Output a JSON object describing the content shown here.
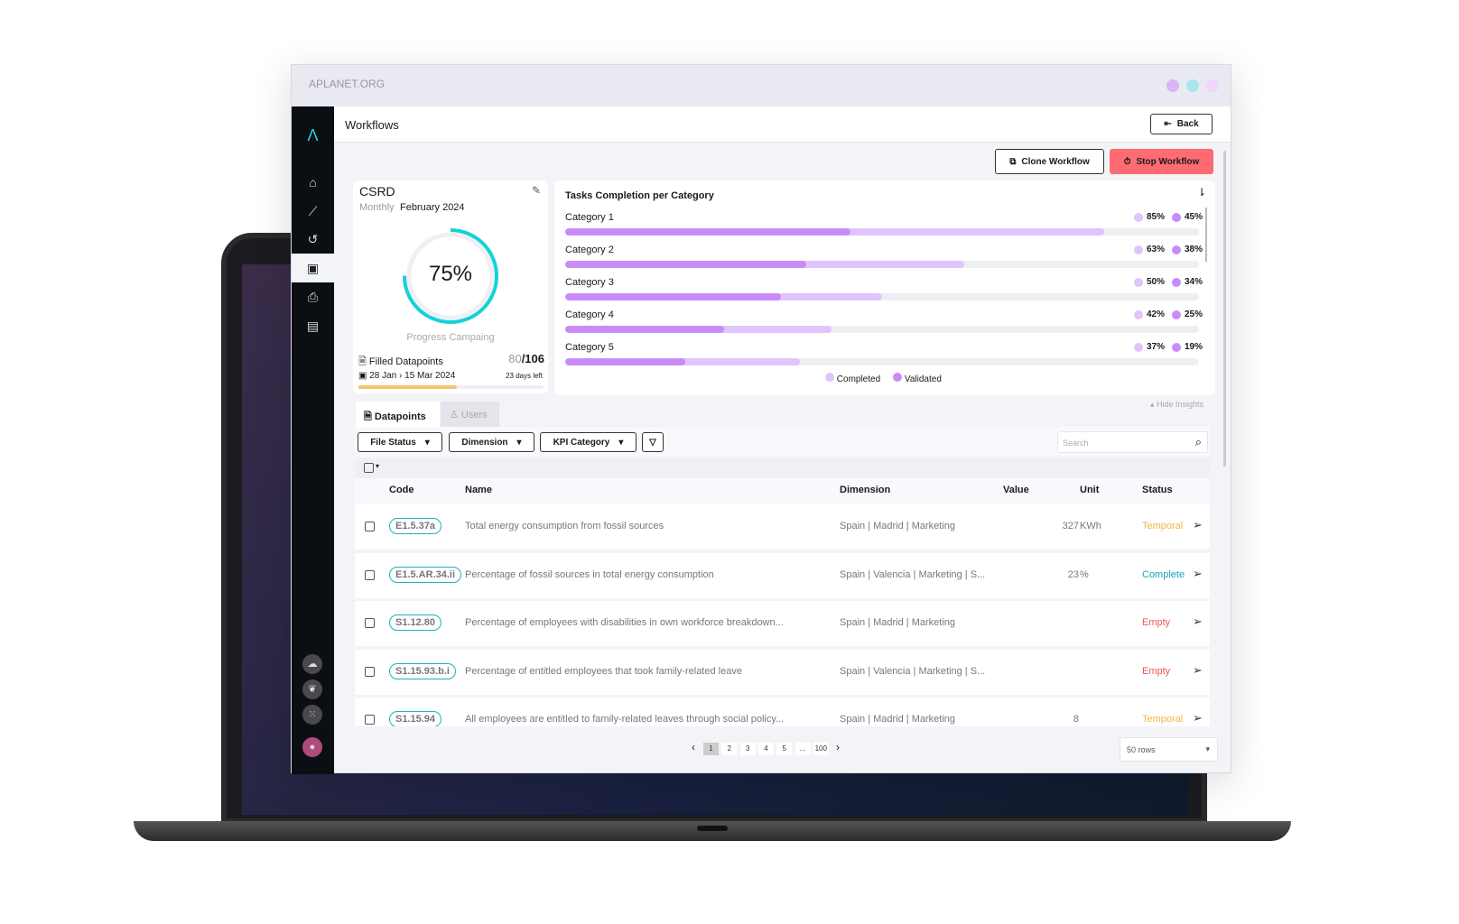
{
  "window": {
    "title": "APLANET.ORG",
    "dots": [
      "#d9b6f5",
      "#a8e6ea",
      "#f0d6fa"
    ]
  },
  "header": {
    "title": "Workflows",
    "back": "Back"
  },
  "actions": {
    "clone": "Clone Workflow",
    "stop": "Stop Workflow",
    "stop_color": "#ff6b72"
  },
  "campaign": {
    "name": "CSRD",
    "frequency": "Monthly",
    "period": "February 2024",
    "progress": 75,
    "progress_label": "75%",
    "progress_caption": "Progress Campaing",
    "filled_label": "Filled Datapoints",
    "filled": "80",
    "total": "/106",
    "start": "28 Jan",
    "end": "15 Mar 2024",
    "days_left": "23 days left",
    "time_elapsed_fraction": 0.53
  },
  "tasks": {
    "title": "Tasks Completion per Category",
    "legend": {
      "completed": "Completed",
      "validated": "Validated"
    },
    "colors": {
      "completed": "#e0c4fb",
      "validated": "#c98cf7"
    },
    "categories": [
      {
        "name": "Category 1",
        "completed": 85,
        "validated": 45,
        "completed_label": "85%",
        "validated_label": "45%"
      },
      {
        "name": "Category 2",
        "completed": 63,
        "validated": 38,
        "completed_label": "63%",
        "validated_label": "38%"
      },
      {
        "name": "Category 3",
        "completed": 50,
        "validated": 34,
        "completed_label": "50%",
        "validated_label": "34%"
      },
      {
        "name": "Category 4",
        "completed": 42,
        "validated": 25,
        "completed_label": "42%",
        "validated_label": "25%"
      },
      {
        "name": "Category 5",
        "completed": 37,
        "validated": 19,
        "completed_label": "37%",
        "validated_label": "19%"
      }
    ],
    "hide": "Hide Insights"
  },
  "tabs": [
    {
      "label": "Datapoints"
    },
    {
      "label": "Users"
    }
  ],
  "filters": [
    "File Status",
    "Dimension",
    "KPI Category"
  ],
  "search": {
    "placeholder": "Search"
  },
  "table": {
    "headers": [
      "Code",
      "Name",
      "Dimension",
      "Value",
      "Unit",
      "Status"
    ],
    "rows": [
      {
        "code": "E1.5.37a",
        "name": "Total energy consumption from fossil sources",
        "dimension": "Spain | Madrid | Marketing",
        "value": "327",
        "unit": "KWh",
        "status": "Temporal"
      },
      {
        "code": "E1.5.AR.34.ii",
        "name": "Percentage of fossil sources in total energy consumption",
        "dimension": "Spain | Valencia | Marketing | S...",
        "value": "23",
        "unit": "%",
        "status": "Complete"
      },
      {
        "code": "S1.12.80",
        "name": "Percentage of employees with disabilities in own workforce breakdown...",
        "dimension": "Spain | Madrid | Marketing",
        "value": "",
        "unit": "",
        "status": "Empty"
      },
      {
        "code": "S1.15.93.b.i",
        "name": "Percentage of entitled employees that took family-related leave",
        "dimension": "Spain | Valencia | Marketing | S...",
        "value": "",
        "unit": "",
        "status": "Empty"
      },
      {
        "code": "S1.15.94",
        "name": "All employees are entitled to family-related leaves through social policy...",
        "dimension": "Spain | Madrid | Marketing",
        "value": "8",
        "unit": "",
        "status": "Temporal"
      }
    ],
    "status_colors": {
      "Temporal": "#f5b345",
      "Complete": "#1aa3b3",
      "Empty": "#f0545c"
    }
  },
  "pagination": {
    "pages": [
      "1",
      "2",
      "3",
      "4",
      "5",
      "...",
      "100"
    ],
    "current": "1",
    "rows": "50 rows"
  }
}
